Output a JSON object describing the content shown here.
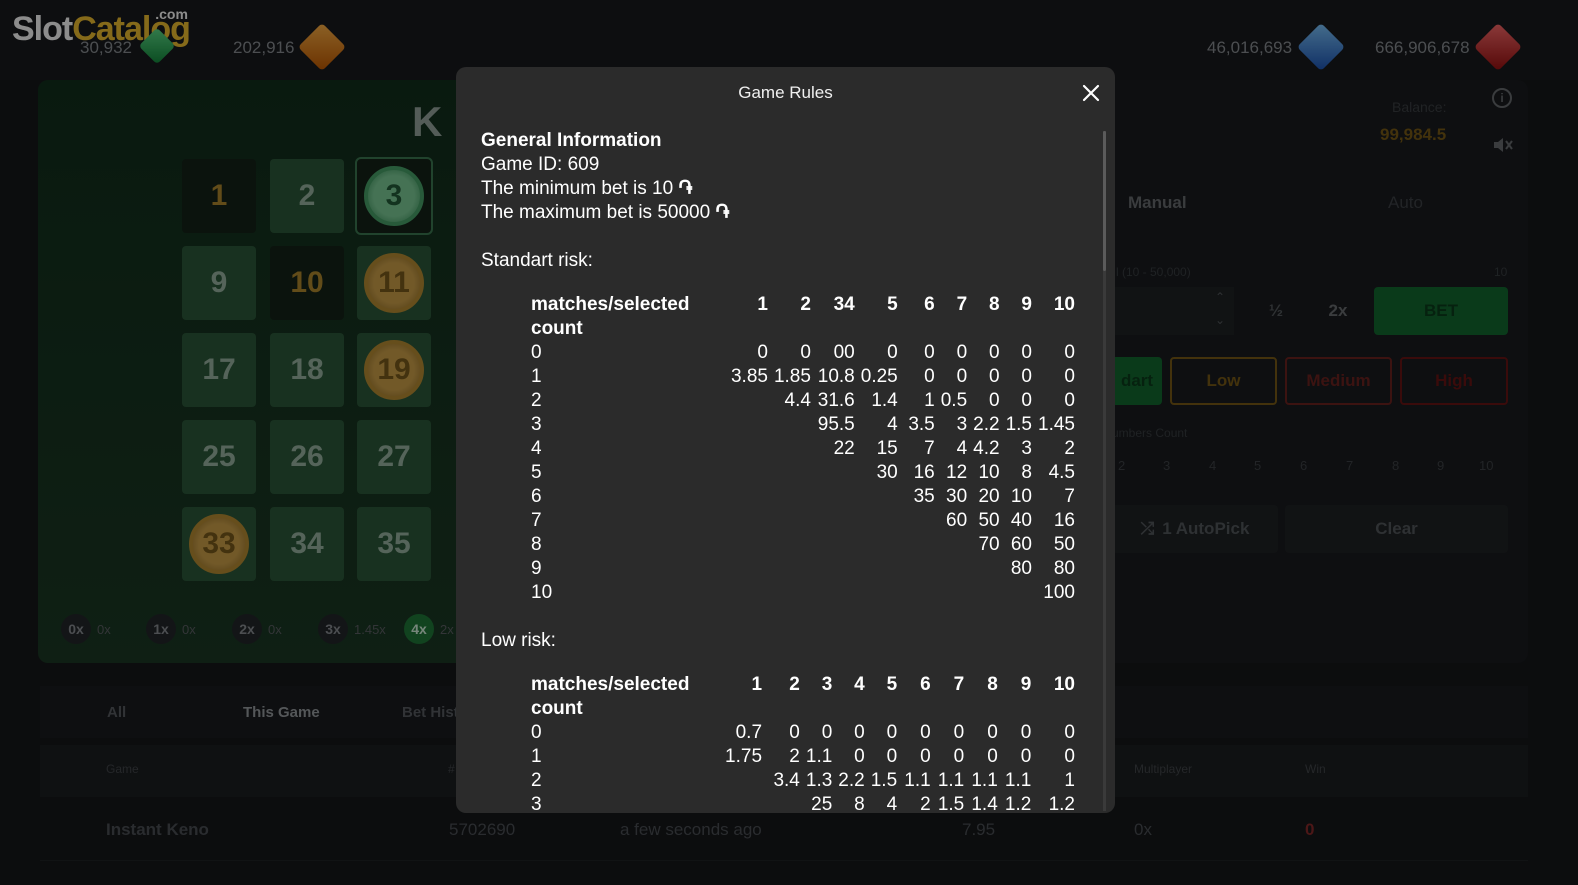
{
  "brand": {
    "slot": "Slot",
    "catalog": "Catalog",
    "com": ".com"
  },
  "header": {
    "stat_green": "30,932",
    "stat_orange": "202,916",
    "stat_blue": "46,016,693",
    "stat_red": "666,906,678"
  },
  "board": {
    "title": "K",
    "cells": [
      "1",
      "2",
      "3",
      "9",
      "10",
      "11",
      "17",
      "18",
      "19",
      "25",
      "26",
      "27",
      "33",
      "34",
      "35"
    ]
  },
  "multipliers": [
    {
      "m": "0x",
      "v": "0x"
    },
    {
      "m": "1x",
      "v": "0x"
    },
    {
      "m": "2x",
      "v": "0x"
    },
    {
      "m": "3x",
      "v": "1.45x"
    },
    {
      "m": "4x",
      "v": "2x"
    }
  ],
  "history": {
    "tabs": [
      "All",
      "This Game",
      "Bet Hist"
    ],
    "headers": {
      "game": "Game",
      "id": "#",
      "mult": "Multiplayer",
      "win": "Win"
    },
    "row": {
      "game": "Instant Keno",
      "id": "5702690",
      "time": "a few seconds ago",
      "bet": "7.95",
      "mult": "0x",
      "win": "0"
    }
  },
  "panel": {
    "balance_label": "Balance:",
    "balance_value": "99,984.5",
    "tab_manual": "Manual",
    "tab_auto": "Auto",
    "bet_range": "l (10 - 50,000)",
    "bet_range_max": "10",
    "half": "½",
    "double": "2x",
    "bet": "BET",
    "risk_standart": "dart",
    "risk_low": "Low",
    "risk_medium": "Medium",
    "risk_high": "High",
    "numbers_count": "umbers Count",
    "nc": [
      "2",
      "3",
      "4",
      "5",
      "6",
      "7",
      "8",
      "9",
      "10"
    ],
    "autopick": "1 AutoPick",
    "clear": "Clear"
  },
  "modal": {
    "title": "Game Rules",
    "general": {
      "heading": "General Information",
      "game_id": "Game ID: 609",
      "min_bet": "The minimum bet is 10",
      "max_bet": "The maximum bet is 50000",
      "currency_symbol": "֏"
    },
    "standart": {
      "label": "Standart risk:",
      "header_col": "matches/selected count",
      "cols": [
        "1",
        "2",
        "34",
        "5",
        "6",
        "7",
        "8",
        "9",
        "10"
      ],
      "rows": [
        [
          "0",
          "0",
          "0",
          "00",
          "0",
          "0",
          "0",
          "0",
          "0",
          "0"
        ],
        [
          "1",
          "3.85",
          "1.85",
          "10.8",
          "0.25",
          "0",
          "0",
          "0",
          "0",
          "0"
        ],
        [
          "2",
          "",
          "4.4",
          "31.6",
          "1.4",
          "1",
          "0.5",
          "0",
          "0",
          "0"
        ],
        [
          "3",
          "",
          "",
          "95.5",
          "4",
          "3.5",
          "3",
          "2.2",
          "1.5",
          "1.45"
        ],
        [
          "4",
          "",
          "",
          "22",
          "15",
          "7",
          "4",
          "4.2",
          "3",
          "2"
        ],
        [
          "5",
          "",
          "",
          "",
          "30",
          "16",
          "12",
          "10",
          "8",
          "4.5"
        ],
        [
          "6",
          "",
          "",
          "",
          "",
          "35",
          "30",
          "20",
          "10",
          "7"
        ],
        [
          "7",
          "",
          "",
          "",
          "",
          "",
          "60",
          "50",
          "40",
          "16"
        ],
        [
          "8",
          "",
          "",
          "",
          "",
          "",
          "",
          "70",
          "60",
          "50"
        ],
        [
          "9",
          "",
          "",
          "",
          "",
          "",
          "",
          "",
          "80",
          "80"
        ],
        [
          "10",
          "",
          "",
          "",
          "",
          "",
          "",
          "",
          "",
          "100"
        ]
      ]
    },
    "low": {
      "label": "Low risk:",
      "header_col": "matches/selected count",
      "cols": [
        "1",
        "2",
        "3",
        "4",
        "5",
        "6",
        "7",
        "8",
        "9",
        "10"
      ],
      "rows": [
        [
          "0",
          "0.7",
          "0",
          "0",
          "0",
          "0",
          "0",
          "0",
          "0",
          "0",
          "0"
        ],
        [
          "1",
          "1.75",
          "2",
          "1.1",
          "0",
          "0",
          "0",
          "0",
          "0",
          "0",
          "0"
        ],
        [
          "2",
          "",
          "3.4",
          "1.3",
          "2.2",
          "1.5",
          "1.1",
          "1.1",
          "1.1",
          "1.1",
          "1"
        ],
        [
          "3",
          "",
          "",
          "25",
          "8",
          "4",
          "2",
          "1.5",
          "1.4",
          "1.2",
          "1.2"
        ]
      ]
    }
  }
}
